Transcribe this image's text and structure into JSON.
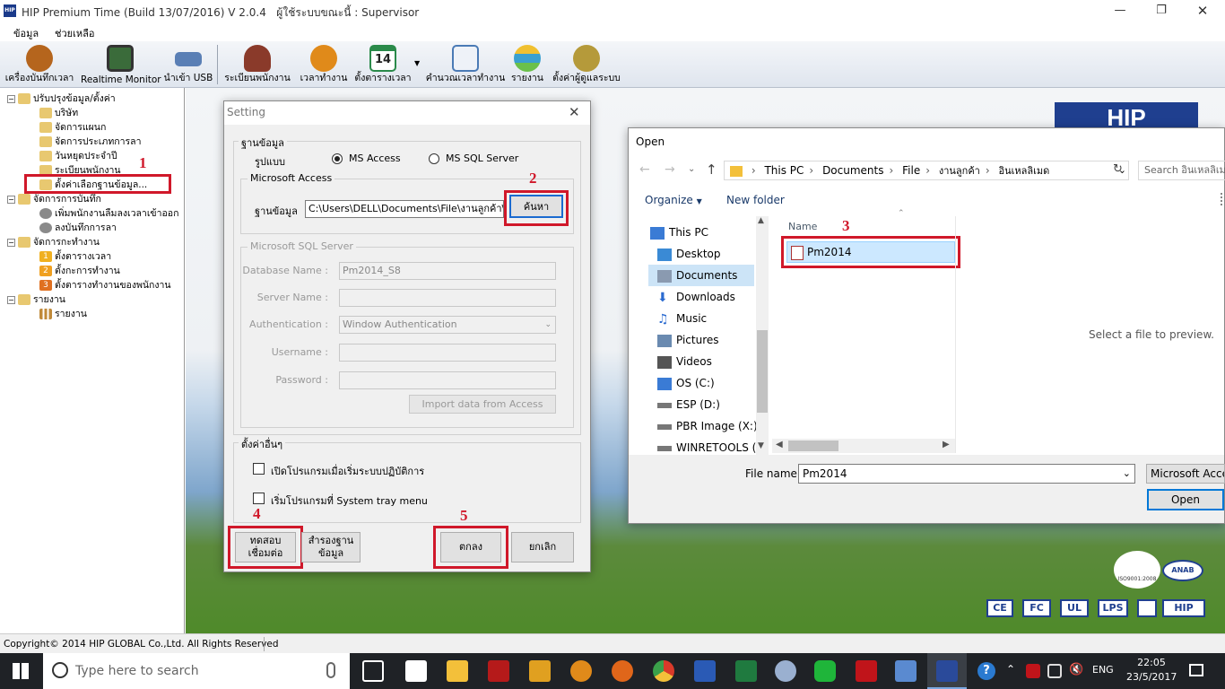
{
  "window": {
    "app_title": "HIP Premium Time (Build 13/07/2016) V 2.0.4",
    "user_label": "ผู้ใช้ระบบขณะนี้ : Supervisor",
    "app_icon_text": "HIP"
  },
  "menu": {
    "items": [
      "ข้อมูล",
      "ช่วยเหลือ"
    ]
  },
  "toolbar": {
    "items": [
      {
        "label": "เครื่องบันทึกเวลา",
        "icon": "alarm-clock-icon",
        "color": "#b5651d"
      },
      {
        "label": "Realtime Monitor",
        "icon": "monitor-icon",
        "color": "#3a6b3a"
      },
      {
        "label": "นำเข้า USB",
        "icon": "usb-icon",
        "color": "#5a7fb5"
      },
      {
        "label": "ระเบียนพนักงาน",
        "icon": "people-icon",
        "color": "#8a3a2a"
      },
      {
        "label": "เวลาทำงาน",
        "icon": "stopwatch-icon",
        "color": "#e08a1a"
      },
      {
        "label": "ตั้งตารางเวลา",
        "icon": "calendar-icon",
        "color": "#2a8a4a",
        "badge": "14"
      },
      {
        "label": "คำนวณเวลาทำงาน",
        "icon": "document-pen-icon",
        "color": "#4a7ab5"
      },
      {
        "label": "รายงาน",
        "icon": "stack-icon",
        "color": "#3aa0d0"
      },
      {
        "label": "ตั้งค่าผู้ดูแลระบบ",
        "icon": "admin-tools-icon",
        "color": "#b59a3a"
      }
    ]
  },
  "tree": {
    "groups": [
      {
        "label": "ปรับปรุงข้อมูล/ตั้งค่า",
        "children": [
          "บริษัท",
          "จัดการแผนก",
          "จัดการประเภทการลา",
          "วันหยุดประจำปี",
          "ระเบียนพนักงาน",
          "ตั้งค่าเลือกฐานข้อมูล..."
        ]
      },
      {
        "label": "จัดการการบันทึก",
        "children": [
          "เพิ่มพนักงานลืมลงเวลาเข้าออก",
          "ลงบันทึกการลา"
        ]
      },
      {
        "label": "จัดการกะทำงาน",
        "children": [
          "ตั้งตารางเวลา",
          "ตั้งกะการทำงาน",
          "ตั้งตารางทำงานของพนักงาน"
        ],
        "child_badges": [
          "1",
          "2",
          "3"
        ]
      },
      {
        "label": "รายงาน",
        "children": [
          "รายงาน"
        ]
      }
    ]
  },
  "setting": {
    "title": "Setting",
    "db_group": "ฐานข้อมูล",
    "type_label": "รูปแบบ",
    "opt_access": "MS Access",
    "opt_sql": "MS SQL Server",
    "access_group": "Microsoft Access",
    "db_label": "ฐานข้อมูล",
    "db_path": "C:\\Users\\DELL\\Documents\\File\\งานลูกค้า\\อินเ",
    "browse": "ค้นหา",
    "sql_group": "Microsoft SQL Server",
    "dbname_label": "Database Name :",
    "dbname_value": "Pm2014_S8",
    "server_label": "Server Name :",
    "auth_label": "Authentication :",
    "auth_value": "Window Authentication",
    "user_label": "Username :",
    "pass_label": "Password :",
    "import_btn": "Import data from Access",
    "other_group": "ตั้งค่าอื่นๆ",
    "chk1": "เปิดโปรแกรมเมื่อเริ่มระบบปฏิบัติการ",
    "chk2": "เริ่มโปรแกรมที่ System tray menu",
    "test_btn_l1": "ทดสอบ",
    "test_btn_l2": "เชื่อมต่อ",
    "backup_btn_l1": "สำรองฐาน",
    "backup_btn_l2": "ข้อมูล",
    "ok_btn": "ตกลง",
    "cancel_btn": "ยกเลิก"
  },
  "open_dialog": {
    "title": "Open",
    "breadcrumb": [
      "This PC",
      "Documents",
      "File",
      "งานลูกค้า",
      "อินเหลลิเมด"
    ],
    "search_placeholder": "Search อินเหลลิเมด",
    "organize": "Organize",
    "new_folder": "New folder",
    "nav": [
      {
        "label": "This PC",
        "icon": "computer-icon",
        "color": "#3a7bd5"
      },
      {
        "label": "Desktop",
        "icon": "desktop-icon",
        "color": "#3a8ad5"
      },
      {
        "label": "Documents",
        "icon": "documents-icon",
        "color": "#8a9ab0",
        "selected": true
      },
      {
        "label": "Downloads",
        "icon": "downloads-icon",
        "color": "#2a6ad0"
      },
      {
        "label": "Music",
        "icon": "music-icon",
        "color": "#2a6ad0"
      },
      {
        "label": "Pictures",
        "icon": "pictures-icon",
        "color": "#6a8ab0"
      },
      {
        "label": "Videos",
        "icon": "videos-icon",
        "color": "#555"
      },
      {
        "label": "OS (C:)",
        "icon": "drive-os-icon",
        "color": "#3a7bd5"
      },
      {
        "label": "ESP (D:)",
        "icon": "drive-icon",
        "color": "#777"
      },
      {
        "label": "PBR Image (X:)",
        "icon": "drive-icon",
        "color": "#777"
      },
      {
        "label": "WINRETOOLS (Y",
        "icon": "drive-icon",
        "color": "#777"
      }
    ],
    "col_name": "Name",
    "file": "Pm2014",
    "preview": "Select a file to preview.",
    "filename_label": "File name:",
    "filename_value": "Pm2014",
    "filetype": "Microsoft Acces",
    "open_btn": "Open"
  },
  "annotations": [
    "1",
    "2",
    "3",
    "4",
    "5"
  ],
  "status": {
    "copyright": "Copyright© 2014 HIP GLOBAL Co.,Ltd. All Rights Reserved"
  },
  "workarea": {
    "logo": "HIP",
    "cert_marks": [
      "CE",
      "FC",
      "UL",
      "LPS",
      "HIP"
    ],
    "iso_seal": "ISO9001:2008",
    "anab_seal": "ANAB"
  },
  "taskbar": {
    "search_placeholder": "Type here to search",
    "lang": "ENG",
    "time": "22:05",
    "date": "23/5/2017",
    "apps": [
      {
        "name": "task-view-icon",
        "color": "#ffffff"
      },
      {
        "name": "store-icon",
        "color": "#ffffff"
      },
      {
        "name": "file-explorer-icon",
        "color": "#f3c03a"
      },
      {
        "name": "filezilla-icon",
        "color": "#b51a1a"
      },
      {
        "name": "outlook-icon",
        "color": "#e0a020"
      },
      {
        "name": "app-my-icon",
        "color": "#e08a1a"
      },
      {
        "name": "firefox-icon",
        "color": "#e0661a"
      },
      {
        "name": "chrome-icon",
        "color": "#3aa04a"
      },
      {
        "name": "word-icon",
        "color": "#2a5ab5"
      },
      {
        "name": "excel-icon",
        "color": "#1f7a3f"
      },
      {
        "name": "paint-icon",
        "color": "#9ab0d0"
      },
      {
        "name": "line-icon",
        "color": "#1fb53a"
      },
      {
        "name": "acrobat-icon",
        "color": "#c0141a"
      },
      {
        "name": "screen-icon",
        "color": "#5a8ad0"
      },
      {
        "name": "hip-app-icon",
        "color": "#2a4a9a"
      }
    ]
  }
}
